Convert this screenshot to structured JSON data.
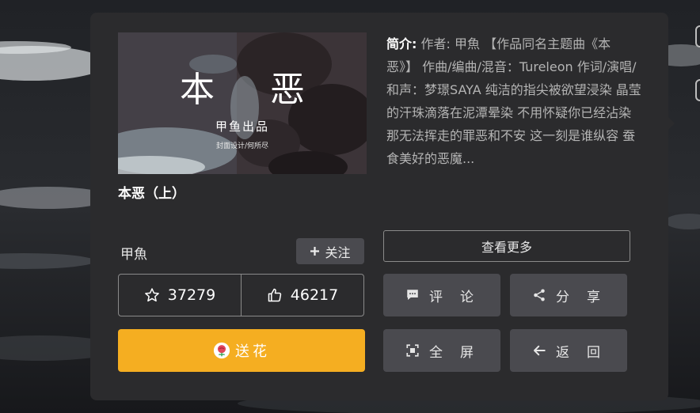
{
  "cover": {
    "title": "本 恶",
    "subtitle": "甲鱼出品",
    "credit": "封面设计/何所尽"
  },
  "work": {
    "title": "本恶（上）",
    "intro_label": "简介:",
    "intro_text": "作者: 甲魚 【作品同名主题曲《本恶》】 作曲/编曲/混音：Tureleon 作词/演唱/和声：梦璟SAYA 纯洁的指尖被欲望浸染 晶莹的汗珠滴落在泥潭晕染 不用怀疑你已经沾染 那无法挥走的罪恶和不安 这一刻是谁纵容 蚕食美好的恶魔..."
  },
  "author": {
    "name": "甲魚",
    "follow_label": "关注"
  },
  "buttons": {
    "more": "查看更多",
    "comment": "评论",
    "share": "分享",
    "fullscreen": "全屏",
    "back": "返回",
    "flower": "送花"
  },
  "stats": {
    "favorites": "37279",
    "likes": "46217"
  },
  "colors": {
    "panel": "#2b2b2d",
    "accent": "#f5ae21",
    "button": "#4a4a4f"
  },
  "icons": [
    "plus-icon",
    "star-icon",
    "thumbs-up-icon",
    "flower-icon",
    "comment-icon",
    "share-icon",
    "fullscreen-icon",
    "arrow-left-icon"
  ]
}
